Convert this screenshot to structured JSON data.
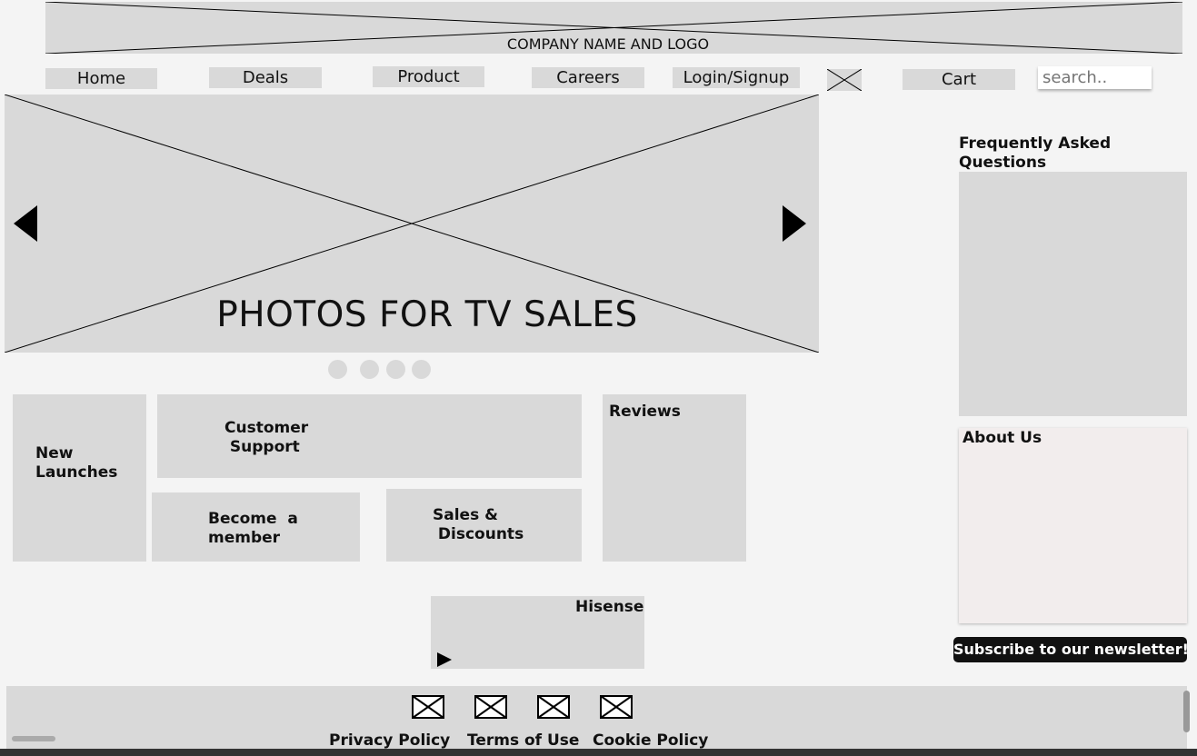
{
  "header": {
    "company_logo_text": "COMPANY NAME AND LOGO"
  },
  "nav": {
    "home": "Home",
    "deals": "Deals",
    "product": "Product",
    "careers": "Careers",
    "login": "Login/Signup",
    "cart": "Cart",
    "search_placeholder": "search.."
  },
  "hero": {
    "caption": "PHOTOS FOR TV SALES",
    "slide_dots": 4
  },
  "tiles": {
    "new_launches": "New\nLaunches",
    "customer_support": "Customer\n Support",
    "become_member": "Become  a\nmember",
    "sales_discounts": "Sales &\n Discounts",
    "reviews": "Reviews",
    "hisense": "Hisense"
  },
  "sidebar": {
    "faq_title": "Frequently Asked\nQuestions",
    "about_title": "About Us",
    "subscribe": "Subscribe to our newsletter!"
  },
  "footer": {
    "privacy": "Privacy Policy",
    "terms": "Terms of Use",
    "cookie": "Cookie Policy",
    "social_icons": [
      "image-placeholder-icon",
      "image-placeholder-icon",
      "image-placeholder-icon",
      "image-placeholder-icon"
    ]
  }
}
